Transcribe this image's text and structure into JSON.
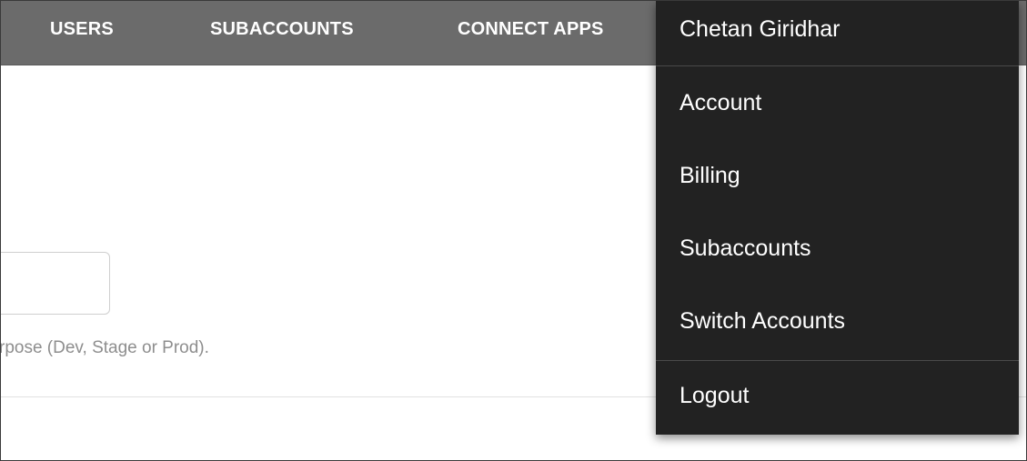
{
  "topnav": {
    "items": [
      {
        "label": "USERS"
      },
      {
        "label": "SUBACCOUNTS"
      },
      {
        "label": "CONNECT APPS"
      }
    ]
  },
  "form": {
    "input_value": "",
    "help_text": "rpose (Dev, Stage or Prod)."
  },
  "user_menu": {
    "user_name": "Chetan Giridhar",
    "items": [
      {
        "label": "Account"
      },
      {
        "label": "Billing"
      },
      {
        "label": "Subaccounts"
      },
      {
        "label": "Switch Accounts"
      }
    ],
    "logout_label": "Logout"
  },
  "colors": {
    "nav_background": "#6b6b6b",
    "menu_background": "#222222",
    "help_text": "#8e8e8e"
  }
}
